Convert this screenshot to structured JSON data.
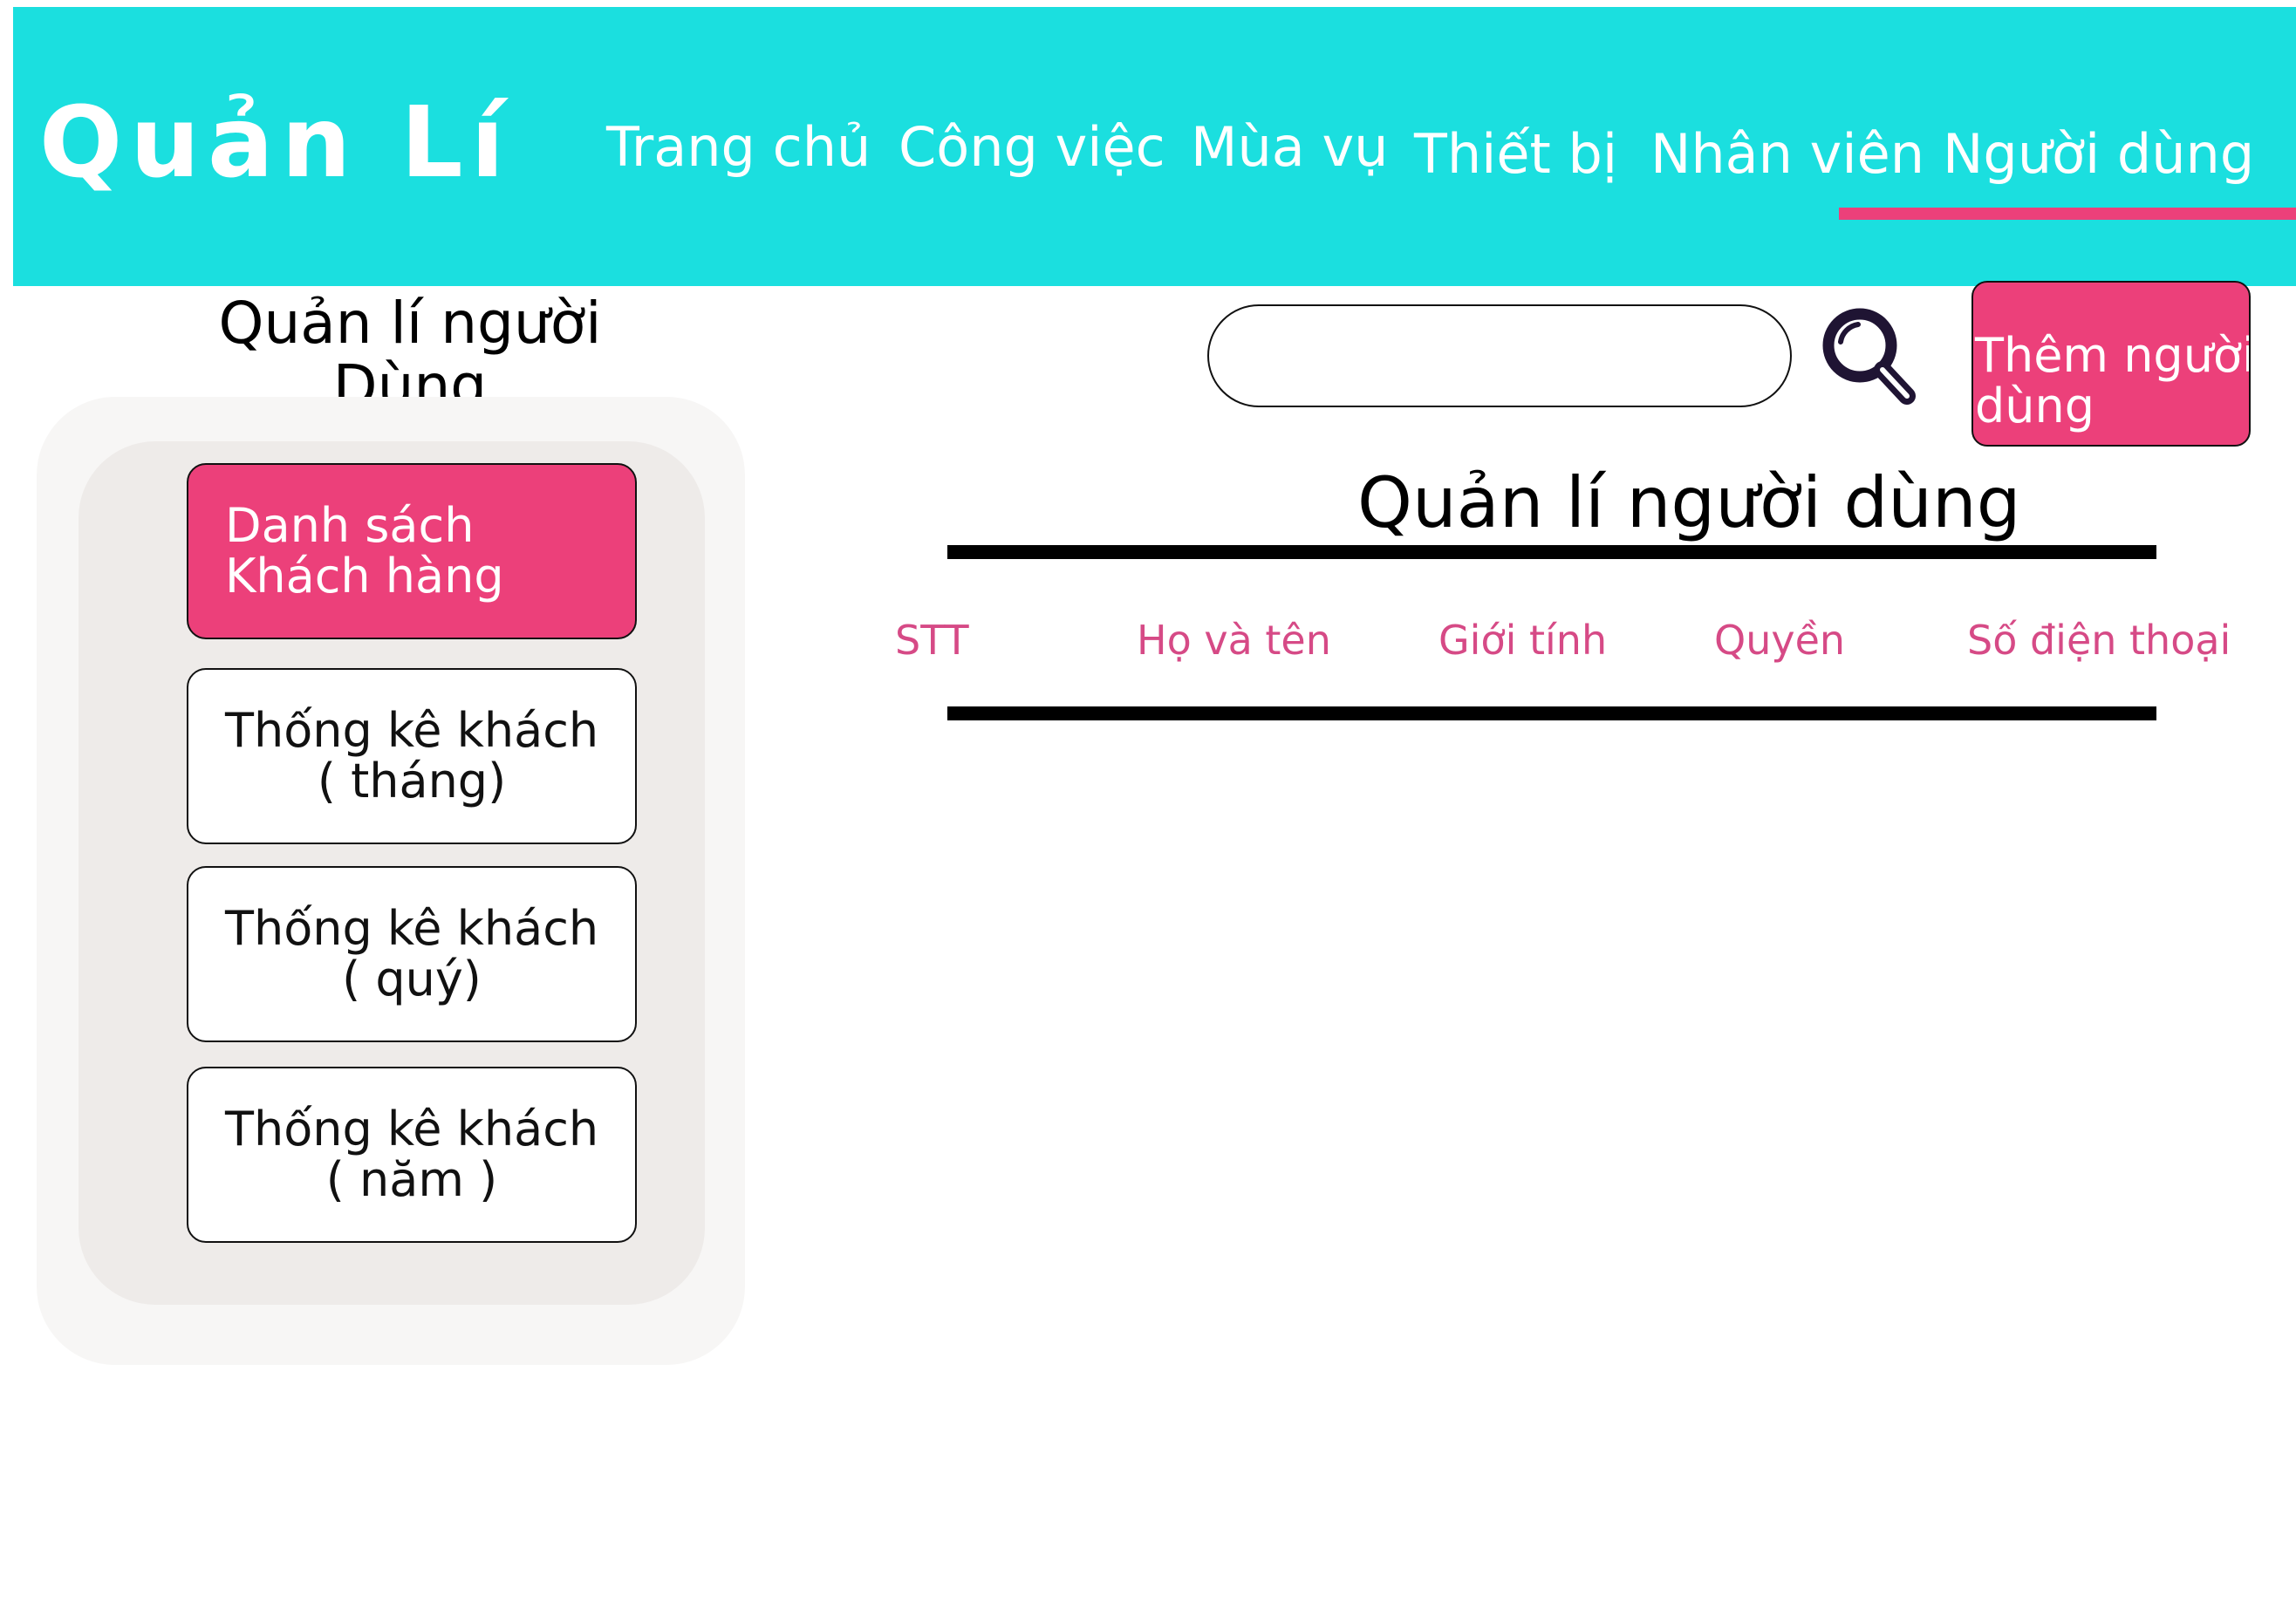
{
  "header": {
    "brand": "Quản Lí",
    "nav": [
      {
        "label": "Trang chủ"
      },
      {
        "label": "Công việc"
      },
      {
        "label": "Mùa vụ"
      },
      {
        "label": "Thiết bị"
      },
      {
        "label": "Nhân viên"
      },
      {
        "label": "Người dùng"
      }
    ],
    "active_nav": "Người dùng"
  },
  "sidebar": {
    "title_line1": "Quản lí người",
    "title_line2": "Dùng",
    "items": [
      {
        "line1": "Danh sách",
        "line2": "Khách hàng",
        "active": true
      },
      {
        "line1": "Thống kê khách",
        "line2": "( tháng)",
        "active": false
      },
      {
        "line1": "Thống kê khách",
        "line2": "( quý)",
        "active": false
      },
      {
        "line1": "Thống kê khách",
        "line2": "( năm )",
        "active": false
      }
    ]
  },
  "search": {
    "value": "",
    "placeholder": "",
    "icon": "search-icon"
  },
  "add_button": {
    "line1": "Thêm người",
    "line2": "dùng"
  },
  "main": {
    "title": "Quản lí người dùng",
    "columns": [
      "STT",
      "Họ và tên",
      "Giới tính",
      "Quyền",
      "Số điện thoại"
    ],
    "rows": []
  },
  "colors": {
    "header_bg": "#1BDFDF",
    "accent": "#EC407A",
    "column_text": "#D64A86",
    "sidebar_outer": "#F7F6F5",
    "sidebar_inner": "#EEEBE9"
  }
}
